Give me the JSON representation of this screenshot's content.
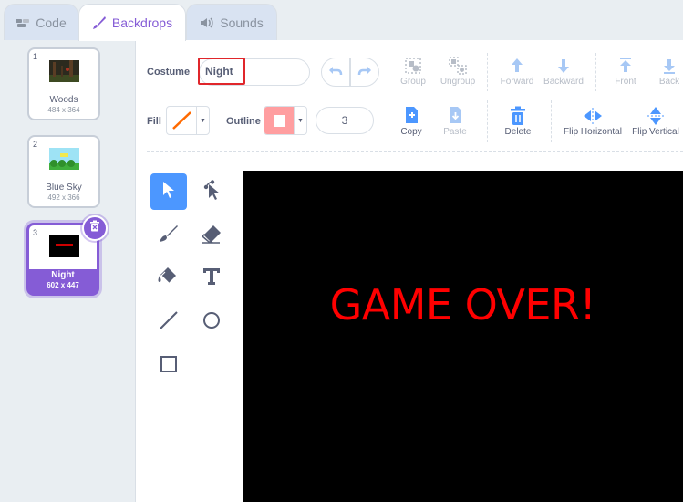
{
  "tabs": [
    {
      "label": "Code",
      "icon": "code-icon"
    },
    {
      "label": "Backdrops",
      "icon": "paintbrush-icon"
    },
    {
      "label": "Sounds",
      "icon": "speaker-icon"
    }
  ],
  "backdrops": [
    {
      "number": "1",
      "name": "Woods",
      "size": "484 x 364"
    },
    {
      "number": "2",
      "name": "Blue Sky",
      "size": "492 x 366"
    },
    {
      "number": "3",
      "name": "Night",
      "size": "602 x 447",
      "selected": true
    }
  ],
  "editor": {
    "costume_label": "Costume",
    "costume_name": "Night",
    "fill_label": "Fill",
    "outline_label": "Outline",
    "outline_width": "3",
    "actions_row1": [
      {
        "label": "Group",
        "icon": "group-icon"
      },
      {
        "label": "Ungroup",
        "icon": "ungroup-icon"
      },
      {
        "label": "Forward",
        "icon": "forward-icon"
      },
      {
        "label": "Backward",
        "icon": "backward-icon"
      },
      {
        "label": "Front",
        "icon": "front-icon"
      },
      {
        "label": "Back",
        "icon": "back-icon"
      }
    ],
    "actions_row2": [
      {
        "label": "Copy",
        "icon": "copy-icon"
      },
      {
        "label": "Paste",
        "icon": "paste-icon"
      },
      {
        "label": "Delete",
        "icon": "trash-icon"
      },
      {
        "label": "Flip Horizontal",
        "icon": "flip-horizontal-icon"
      },
      {
        "label": "Flip Vertical",
        "icon": "flip-vertical-icon"
      }
    ],
    "tools": [
      "select",
      "reshape",
      "brush",
      "eraser",
      "fill",
      "text",
      "line",
      "circle",
      "rectangle"
    ]
  },
  "canvas_text": "GAME OVER!",
  "colors": {
    "accent": "#855cd6",
    "tool_selected": "#4c97ff",
    "fill_stroke": "#ff6a00",
    "outline_fill": "#ff9ea0",
    "highlight": "#e0262b",
    "canvas_bg": "#000000",
    "canvas_text": "#ff0000"
  }
}
